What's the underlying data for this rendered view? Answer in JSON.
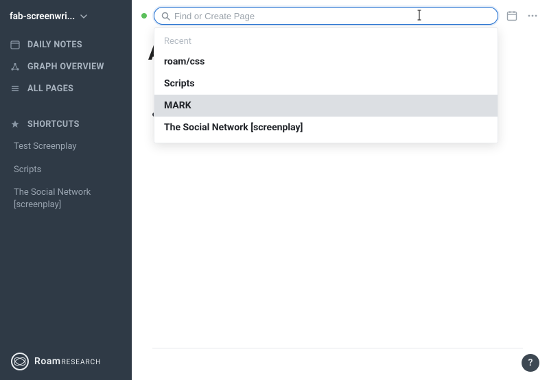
{
  "db": {
    "name": "fab-screenwri..."
  },
  "sidebar": {
    "daily_notes": "DAILY NOTES",
    "graph_overview": "GRAPH OVERVIEW",
    "all_pages": "ALL PAGES",
    "shortcuts_header": "SHORTCUTS",
    "shortcuts": [
      {
        "label": "Test Screenplay"
      },
      {
        "label": "Scripts"
      },
      {
        "label": "The Social Network [screenplay]"
      }
    ]
  },
  "brand": {
    "roam": "Roam",
    "research": "RESEARCH"
  },
  "search": {
    "placeholder": "Find or Create Page",
    "value": "",
    "dropdown": {
      "header": "Recent",
      "items": [
        {
          "label": "roam/css",
          "highlighted": false
        },
        {
          "label": "Scripts",
          "highlighted": false
        },
        {
          "label": "MARK",
          "highlighted": true
        },
        {
          "label": "The Social Network [screenplay]",
          "highlighted": false
        }
      ]
    }
  },
  "page": {
    "visible_title_fragment": "A"
  },
  "help": {
    "label": "?"
  }
}
